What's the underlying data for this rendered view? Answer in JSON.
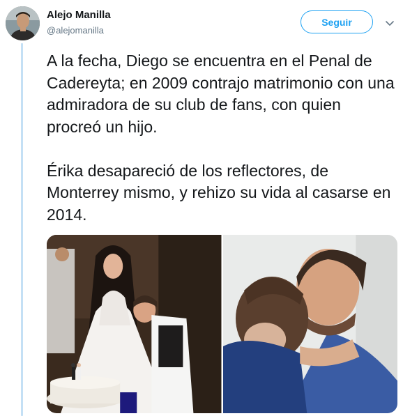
{
  "header": {
    "name": "Alejo Manilla",
    "handle": "@alejomanilla",
    "follow_label": "Seguir"
  },
  "tweet": {
    "paragraphs": [
      "A la fecha, Diego se encuentra en el Penal de Cadereyta; en 2009 contrajo matrimonio con una admiradora de su club de fans, con quien procreó un hijo.",
      "Érika desapareció de los reflectores, de Monterrey mismo, y rehizo su vida al casarse en 2014."
    ]
  },
  "media": {
    "photos": [
      {
        "subject": "wedding-cake-photo"
      },
      {
        "subject": "father-son-hug-photo"
      }
    ]
  },
  "colors": {
    "accent": "#1da1f2",
    "thread_line": "#c4e0f5",
    "text": "#14171a",
    "secondary_text": "#657786"
  },
  "icons": {
    "menu": "chevron-down-icon"
  }
}
